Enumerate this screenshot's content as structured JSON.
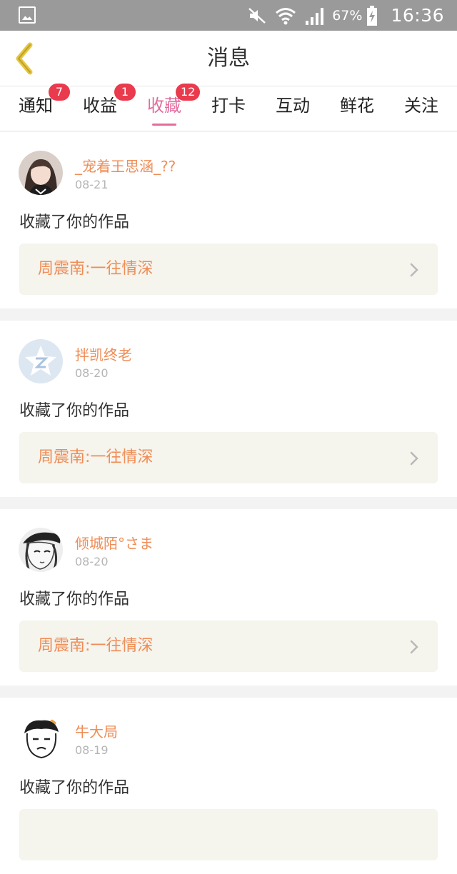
{
  "status_bar": {
    "battery_percent": "67%",
    "time": "16:36",
    "icons": [
      "image-icon",
      "mute-icon",
      "wifi-icon",
      "signal-icon",
      "battery-charging-icon"
    ]
  },
  "header": {
    "title": "消息",
    "back_icon": "chevron-left-icon",
    "accent_color": "#e7c63c"
  },
  "tabs": [
    {
      "label": "通知",
      "badge": "7"
    },
    {
      "label": "收益",
      "badge": "1"
    },
    {
      "label": "收藏",
      "badge": "12",
      "active": true
    },
    {
      "label": "打卡"
    },
    {
      "label": "互动"
    },
    {
      "label": "鲜花"
    },
    {
      "label": "关注"
    }
  ],
  "colors": {
    "active_tab": "#e36d9e",
    "badge": "#ea3a4d",
    "username": "#ef8d57",
    "work_title": "#ef8d57",
    "work_box_bg": "#f5f4ed"
  },
  "feed": [
    {
      "username": "_宠着王思涵_??",
      "date": "08-21",
      "action": "收藏了你的作品",
      "work": "周震南:一往情深",
      "avatar": "photo-avatar"
    },
    {
      "username": "拌凯终老",
      "date": "08-20",
      "action": "收藏了你的作品",
      "work": "周震南:一往情深",
      "avatar": "default-qq-avatar"
    },
    {
      "username": "倾城陌°さま",
      "date": "08-20",
      "action": "收藏了你的作品",
      "work": "周震南:一往情深",
      "avatar": "anime-avatar"
    },
    {
      "username": "牛大局",
      "date": "08-19",
      "action": "收藏了你的作品",
      "work": "",
      "avatar": "cartoon-avatar"
    }
  ]
}
